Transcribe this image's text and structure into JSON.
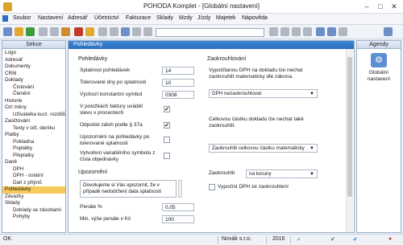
{
  "window": {
    "title": "POHODA Komplet - [Globální nastavení]"
  },
  "menu": [
    "Soubor",
    "Nastavení",
    "Adresář",
    "Účetnictví",
    "Fakturace",
    "Sklady",
    "Mzdy",
    "Jízdy",
    "Majetek",
    "Nápověda"
  ],
  "sidebar": {
    "header": "Sekce",
    "items": [
      "Logo",
      "Adresář",
      "Dokumenty",
      "CRM",
      "Doklady",
      "Číslování",
      "Členění",
      "Historie",
      "Ozí měny",
      "Uživatelka kurz. rozdílů",
      "Zaúčtování",
      "Texty v účt. deníku",
      "Platby",
      "Pokladna",
      "Poplatky",
      "Přeplatky",
      "Daně",
      "DPH",
      "DPH - ostatní",
      "Daň z příjmů",
      "Pohledávky",
      "Závazky",
      "Sklady",
      "Doklady se zásobami",
      "Pohyby"
    ],
    "selected": "Pohledávky"
  },
  "main": {
    "header": "Pohledávky",
    "left": {
      "section": "Pohledávky",
      "splatnost_label": "Splatnost pohledávek",
      "splatnost_value": "14",
      "tolerovane_label": "Tolerované dny po splatnosti",
      "tolerovane_value": "10",
      "symbol_label": "Výchozí konstantní symbol",
      "symbol_value": "0308",
      "slevy_label": "V položkách faktury uvádět slevu v procentech",
      "slevy_checked": "✔",
      "odpocet_label": "Odpočet záloh podle § 37a",
      "odpocet_checked": "✔",
      "upozorneni_label": "Upozornění na pohledávky po tolerované splatnosti",
      "upozorneni_checked": "",
      "vytvoreni_label": "Vytvoření variabilního symbolu z čísla objednávky",
      "vytvoreni_checked": "",
      "upozorneni_section": "Upozornění",
      "upozorneni_text": "Dovolujeme si Vás upozornit, že v případě nedodržení data splatnosti",
      "penale_label": "Penále %",
      "penale_value": "0,05",
      "min_penale_label": "Min. výše penále v Kč",
      "min_penale_value": "100"
    },
    "right": {
      "section": "Zaokrouhlování",
      "dph_text": "Vypočítanou DPH na dokladu lze nechat zaokrouhlit matematicky dle zákona.",
      "dph_select": "DPH nezaokrouhlovat",
      "celkova_text": "Celkovou částku dokladu lze nechat také zaokrouhlit.",
      "celkova_select": "Zaokrouhlit celkovou částku matematicky",
      "zaokr_label": "Zaokrouhlit",
      "zaokr_select": "na koruny",
      "vypocet_label": "Vypočíst DPH ze zaokrouhlení",
      "vypocet_checked": ""
    }
  },
  "agendy": {
    "header": "Agendy",
    "item": "Globální nastavení"
  },
  "status": {
    "left": "OK",
    "company": "Novák s.r.o.",
    "year": "2016"
  },
  "colors": {
    "accent": "#2a6fbf",
    "selected": "#f6c95b"
  }
}
